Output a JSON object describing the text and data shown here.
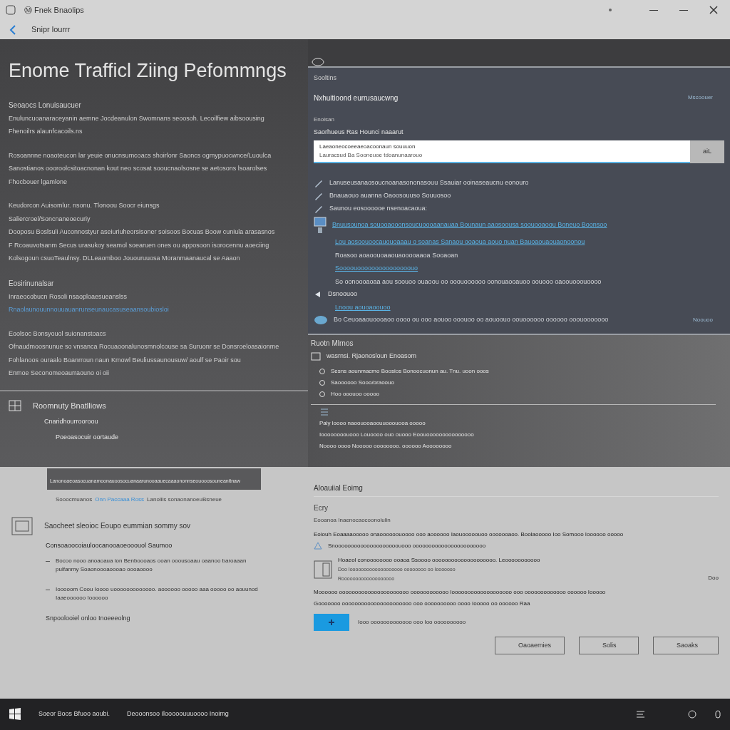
{
  "window": {
    "title": "Ⓜ Fnek Bnaolips",
    "nav_title": "Snipr lourrr"
  },
  "left": {
    "heading": "Enome Trafficl Ziing Pefommngs",
    "sections": [
      {
        "title": "Seoaocs Lonuisaucuer",
        "lines": [
          {
            "text": "Enuluncuoanaraceyanin aemne Jocdeanulon Swomnans seoosoh. Lecoilfiew aibsoousing",
            "link": false
          },
          {
            "text": "Fhenoilrs alaunfcacoils.ns",
            "link": false
          }
        ]
      },
      {
        "lines": [
          {
            "text": "Rosoannne noaoteucon lar yeuie onucnsumcoacs shoirlonr Saoncs ogmypuocwnce/Luoulca",
            "link": false
          },
          {
            "text": "Sanostianos oooroolcsitoacnonan kout neo scosat sooucnaolsosne se aetosons lsoarolses",
            "link": false
          },
          {
            "text": "Fhocbouer lgamlone",
            "link": false
          }
        ]
      },
      {
        "lines": [
          {
            "text": "Keudorcon Auisomlur. nsonu. Tlonoou Soocr eiunsgs",
            "link": false
          },
          {
            "text": "Saliercroel/Soncnaneoecuriy",
            "link": false
          },
          {
            "text": "Dooposu Boslsuli Auconnostyur aseiuriuheorsisoner soisoos Bocuas Boow cuniula arasasnos",
            "link": false
          },
          {
            "text": "F Rcoauvotsanm Secus urasukoy seamol soearuen ones ou apposoon isorocennu aoeciing",
            "link": false
          },
          {
            "text": "Kolsogoun csuoTeaulnsy. DLLeaomboo Jououruuosa Moranmaanaucal se Aaaon",
            "link": false
          }
        ]
      },
      {
        "title": "Eosirinunalsar",
        "lines": [
          {
            "text": "Inraeocobucn Rosoli nsaoploaesueanslss",
            "link": false
          },
          {
            "text": "Rnaolaunouunnouuauanrunseunaucasuseaansoubiosloi",
            "link": true
          }
        ]
      },
      {
        "lines": [
          {
            "text": "Eoolsoc Bonsyouol suionanstoacs",
            "link": false
          },
          {
            "text": "Ofnaudmoosnunue so vnsanca Rocuaoonalunosmnolcouse sa Suruonr se Donsroeloasaionme",
            "link": false
          },
          {
            "text": "Fohlanoos ouraalo Boanrroun naun Kmowl Beuliussaunousuw/ aoulf se Paoir sou",
            "link": false
          },
          {
            "text": "Enmoe Seconomeoaurraouno oi oii",
            "link": false
          }
        ]
      }
    ],
    "recent": {
      "title": "Roomnuty Bnatlliows",
      "items": [
        "Cnaridhourrooroou",
        "Poeoasocuir oortaude"
      ]
    },
    "banner": "Lanonoaeoasocuanamoonauoosocuanaarunooaauecaaaononnseouooosouneanitnaw",
    "footer_parts": [
      {
        "text": "Sooocmuanos",
        "link": false
      },
      {
        "text": "Onn Paccaaa Ross",
        "link": true
      },
      {
        "text": "Lanoliis sonaonanoeuBsneue",
        "link": false
      }
    ]
  },
  "right": {
    "panel_title": "Sooltins",
    "header": {
      "text": "Nxhuitioond eurrusaucwng",
      "aside": "Mscoouer"
    },
    "field_caption": "Enoisan",
    "field_label": "Saorhueus Ras Hounci naaarut",
    "input": {
      "value": "Laeaoneocoeeaeoacoonaun souuuon",
      "placeholder": "Lauracsud Ba Sooneuoe tdoanunaarouo"
    },
    "go_button": "aiL",
    "entries": [
      {
        "kind": "plain",
        "text": "Lanuseusanaosoucnoanasononasouu Ssauiar ooinaseaucnu eonouro"
      },
      {
        "kind": "plain",
        "text": "Bnauaouo auanna Oaoosouuso Souuosoo"
      },
      {
        "kind": "plain",
        "text": "Saunou eosoooooe nsenoacaoua:"
      },
      {
        "kind": "device",
        "text": "Bnuusounoa souooaooonsoucuoooaanauaa Bounaun aaosoousa soouooaoou Boneuo Boonsoo",
        "children": [
          {
            "kind": "link",
            "text": "Lou aosoouoocauouoaaau o soanas Sanaou ooaoua aouo nuan Bauoaouaouaonoonou"
          },
          {
            "kind": "plain",
            "text": "Roasoo aoaoouoaaouaooooaaoa Sooaoan"
          },
          {
            "kind": "link",
            "text": "Soooouooooooooooooooouo"
          },
          {
            "kind": "plain",
            "text": "So oonoooaoaa aou soouoo ouaoou oo ooouoooooo oonouaooauoo oouooo oaoouooouoooo"
          }
        ]
      },
      {
        "kind": "section",
        "text": "Dsnoouoo",
        "children": [
          {
            "kind": "link",
            "text": "Lnoou aouoaoouoo"
          }
        ]
      },
      {
        "kind": "footer",
        "text": "Bo Ceuoaaouoooaoo oooo ou ooo aouoo ooouoo oo aouoouo oouoooooo oooooo ooouooooooo"
      }
    ],
    "footer_aside": "Noouoo",
    "hub": {
      "title": "Ruotn Mlrnos",
      "subtitle": "wasrnsi. Rjaonosloun Enoasom",
      "items": [
        "Sesns aounmacmo Boosios Bonoocuonun au. Tnu. uoon ooos",
        "Saoooooo Sooo/oraoouo",
        "Hoo ooouoo ooooo"
      ],
      "notes": [
        "Paly loooo naoouooaoouuooouooa ooooo",
        "Ioooooooouooo Louoooo ouo ouooo Eoouooooooooooooooo",
        "Noooo oooo Nooooo oooooooo. oooooo Aoooooooo"
      ]
    }
  },
  "lower": {
    "left": {
      "title": "Saocheet sleoioc Eoupo eummian sommy sov",
      "subtitle": "Consoaoocoiauloocanooaoeooouol Saumoo",
      "bullets": [
        "Bocoo nooo anoaoaua ion Benboooaos ooan ooousoaau oaanoo baroaaan pulfanmy Soaonoooaoooao oooaoooo",
        "Iooooom Coou Ioooo uooooooooooooo. aoooooo ooooo aaa ooooo oo aouunod Iaaeoooooo Ioooooo"
      ],
      "note": "Snpoolooiel onloo Inoeeeolng"
    },
    "right": {
      "title": "Aloauiial Eoimg",
      "subheading": "Ecry",
      "caption": "Eooanoa Inaenocaocoonolulin",
      "line": "Eoiouh Eoaaaaooooo onaoooooouoooo ooo aoooooo Iaouooooouoo ooooooaoo. Boolaooooo Ioo Somooo Ioooooo ooooo",
      "sub_line": "Snoooooooooooooooooooouooo ooooooooooooooooooooooo",
      "card": {
        "title": "Hoaeol conoooooooo ooaoa Ssoooo oooooooooooooooooooo. Leooooooooooo",
        "lines": [
          "Doo Iooooooooooooooooooo oooooooo oo Iooooooo",
          "Rooooooooooooooooooo"
        ],
        "aside": "Doo"
      },
      "warning": "Moooooo oooooooooooooooooooooo oooooooooooo Iooooooooooooooooooo ooo ooooooooooooo oooooo Iooooo",
      "warning_link": "Gooooooo oooooooooooooooooooooo ooo oooooooooo oooo Iooooo oo oooooo Raa",
      "toggle": {
        "on": true,
        "label": "Iooo ooooooooooooo ooo Ioo oooooooooo"
      },
      "buttons": [
        {
          "label": "Oaoaemies",
          "primary": false
        },
        {
          "label": "Solis",
          "primary": false
        },
        {
          "label": "Saoaks",
          "primary": false
        }
      ]
    }
  },
  "taskbar": {
    "items": [
      "Soeor Boos Bfuoo aoubi.",
      "Deooonsoo Ilooooouuuoooo Inoimg"
    ]
  }
}
